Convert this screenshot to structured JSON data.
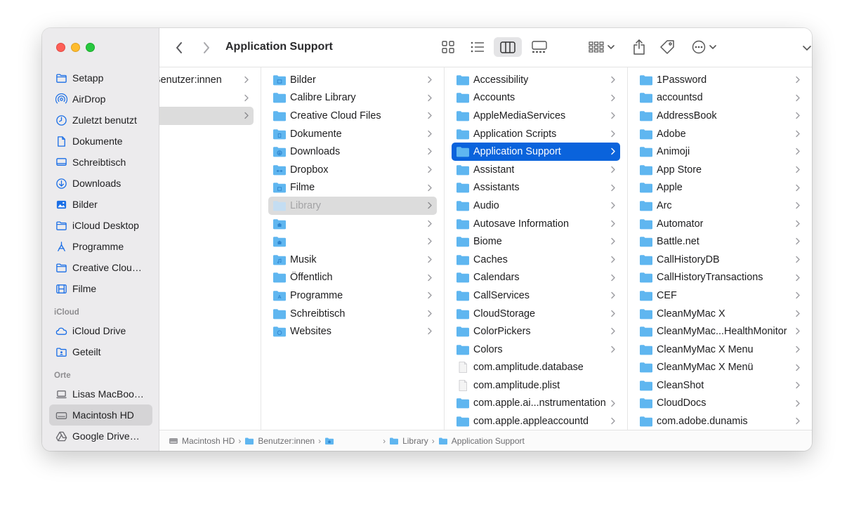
{
  "toolbar": {
    "title": "Application Support"
  },
  "sidebar": {
    "top_items": [
      {
        "label": "Setapp",
        "icon": "folder-icon"
      },
      {
        "label": "AirDrop",
        "icon": "airdrop-icon"
      },
      {
        "label": "Zuletzt benutzt",
        "icon": "clock-icon"
      },
      {
        "label": "Dokumente",
        "icon": "document-icon"
      },
      {
        "label": "Schreibtisch",
        "icon": "desktop-icon"
      },
      {
        "label": "Downloads",
        "icon": "download-icon"
      },
      {
        "label": "Bilder",
        "icon": "photo-icon"
      },
      {
        "label": "iCloud Desktop",
        "icon": "folder-icon"
      },
      {
        "label": "Programme",
        "icon": "apps-icon"
      },
      {
        "label": "Creative Clou…",
        "icon": "folder-icon"
      },
      {
        "label": "Filme",
        "icon": "film-icon"
      }
    ],
    "icloud_heading": "iCloud",
    "icloud_items": [
      {
        "label": "iCloud Drive",
        "icon": "cloud-icon"
      },
      {
        "label": "Geteilt",
        "icon": "shared-folder-icon"
      }
    ],
    "locations_heading": "Orte",
    "location_items": [
      {
        "label": "Lisas MacBoo…",
        "icon": "laptop-icon"
      },
      {
        "label": "Macintosh HD",
        "icon": "disk-icon"
      },
      {
        "label": "Google Drive…",
        "icon": "drive-icon"
      }
    ]
  },
  "columns": {
    "col0": [
      {
        "label": "Benutzer:innen"
      },
      {
        "label": ""
      },
      {
        "label": ""
      }
    ],
    "col1": [
      {
        "label": "Bilder"
      },
      {
        "label": "Calibre Library"
      },
      {
        "label": "Creative Cloud Files"
      },
      {
        "label": "Dokumente"
      },
      {
        "label": "Downloads"
      },
      {
        "label": "Dropbox"
      },
      {
        "label": "Filme"
      },
      {
        "label": "Library"
      },
      {
        "label": ""
      },
      {
        "label": ""
      },
      {
        "label": "Musik"
      },
      {
        "label": "Öffentlich"
      },
      {
        "label": "Programme"
      },
      {
        "label": "Schreibtisch"
      },
      {
        "label": "Websites"
      }
    ],
    "col2": [
      {
        "label": "Accessibility"
      },
      {
        "label": "Accounts"
      },
      {
        "label": "AppleMediaServices"
      },
      {
        "label": "Application Scripts"
      },
      {
        "label": "Application Support"
      },
      {
        "label": "Assistant"
      },
      {
        "label": "Assistants"
      },
      {
        "label": "Audio"
      },
      {
        "label": "Autosave Information"
      },
      {
        "label": "Biome"
      },
      {
        "label": "Caches"
      },
      {
        "label": "Calendars"
      },
      {
        "label": "CallServices"
      },
      {
        "label": "CloudStorage"
      },
      {
        "label": "ColorPickers"
      },
      {
        "label": "Colors"
      },
      {
        "label": "com.amplitude.database"
      },
      {
        "label": "com.amplitude.plist"
      },
      {
        "label": "com.apple.ai...nstrumentation"
      },
      {
        "label": "com.apple.appleaccountd"
      }
    ],
    "col3": [
      {
        "label": "1Password"
      },
      {
        "label": "accountsd"
      },
      {
        "label": "AddressBook"
      },
      {
        "label": "Adobe"
      },
      {
        "label": "Animoji"
      },
      {
        "label": "App Store"
      },
      {
        "label": "Apple"
      },
      {
        "label": "Arc"
      },
      {
        "label": "Automator"
      },
      {
        "label": "Battle.net"
      },
      {
        "label": "CallHistoryDB"
      },
      {
        "label": "CallHistoryTransactions"
      },
      {
        "label": "CEF"
      },
      {
        "label": "CleanMyMac X"
      },
      {
        "label": "CleanMyMac...HealthMonitor"
      },
      {
        "label": "CleanMyMac X Menu"
      },
      {
        "label": "CleanMyMac X Menü"
      },
      {
        "label": "CleanShot"
      },
      {
        "label": "CloudDocs"
      },
      {
        "label": "com.adobe.dunamis"
      }
    ]
  },
  "pathbar": {
    "c0": "Macintosh HD",
    "c1": "Benutzer:innen",
    "c2": "",
    "c3": "Library",
    "c4": "Application Support"
  },
  "colors": {
    "selection": "#0a63dc",
    "folder": "#5fb6f0",
    "sidebar_icon": "#1a6ee6"
  }
}
